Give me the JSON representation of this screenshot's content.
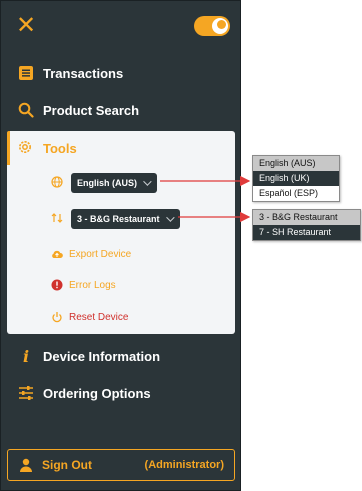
{
  "colors": {
    "accent": "#f5a623",
    "panel_bg": "#2b3539",
    "tools_bg": "#f3f5f7",
    "danger": "#d0312d",
    "arrow": "#e03b3b"
  },
  "nav": {
    "transactions": {
      "label": "Transactions",
      "icon": "list-icon"
    },
    "product_search": {
      "label": "Product Search",
      "icon": "search-icon"
    },
    "tools": {
      "label": "Tools",
      "icon": "gear-icon"
    },
    "device_information": {
      "label": "Device Information",
      "icon": "info-icon"
    },
    "ordering_options": {
      "label": "Ordering Options",
      "icon": "sliders-icon"
    }
  },
  "tools": {
    "language_select": {
      "value": "English (AUS)",
      "icon": "globe-icon"
    },
    "restaurant_select": {
      "value": "3 - B&G Restaurant",
      "icon": "swap-icon"
    },
    "export_device": "Export Device",
    "error_logs": "Error Logs",
    "reset_device": "Reset Device"
  },
  "language_dropdown": {
    "options": [
      "English (AUS)",
      "English (UK)",
      "Español (ESP)"
    ]
  },
  "restaurant_dropdown": {
    "options": [
      "3 - B&G Restaurant",
      "7 - SH Restaurant"
    ]
  },
  "signout": {
    "label": "Sign Out",
    "role": "(Administrator)",
    "icon": "user-icon"
  }
}
